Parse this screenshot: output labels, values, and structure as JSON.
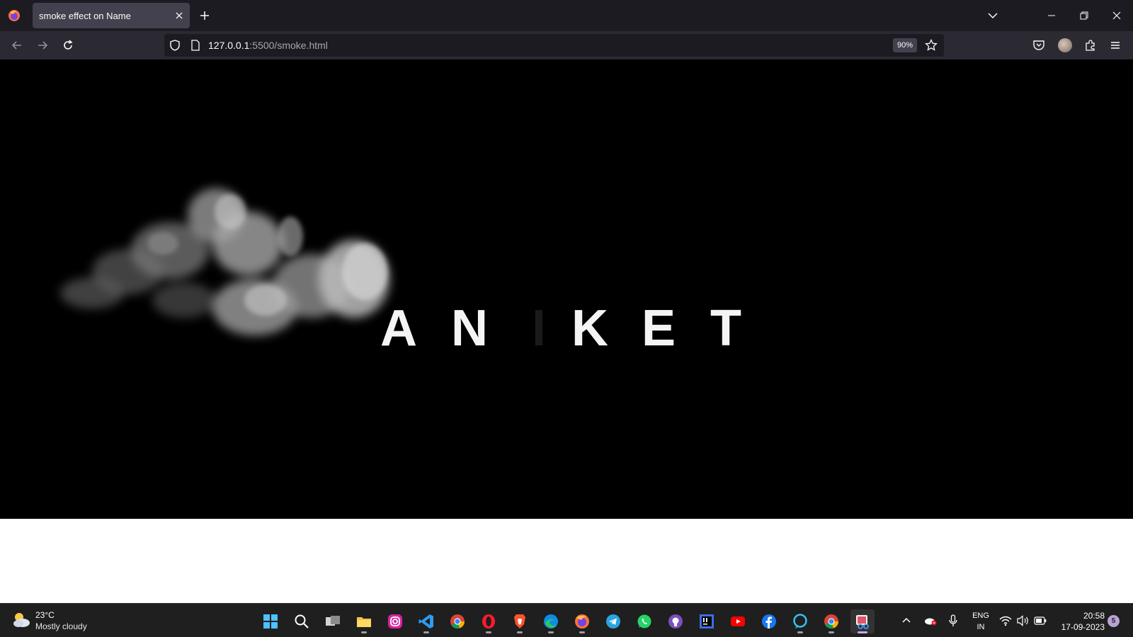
{
  "browser": {
    "tab": {
      "title": "smoke effect on Name"
    },
    "url": {
      "host": "127.0.0.1",
      "path": ":5500/smoke.html"
    },
    "zoom": "90%"
  },
  "page": {
    "letters": [
      "A",
      "N",
      "I",
      "K",
      "E",
      "T"
    ]
  },
  "taskbar": {
    "weather": {
      "temp": "23°C",
      "condition": "Mostly cloudy"
    },
    "apps": [
      {
        "name": "start",
        "icon": "windows-icon"
      },
      {
        "name": "search",
        "icon": "search-icon"
      },
      {
        "name": "task-view",
        "icon": "task-view-icon"
      },
      {
        "name": "file-explorer",
        "icon": "folder-icon"
      },
      {
        "name": "instagram",
        "icon": "instagram-icon"
      },
      {
        "name": "vscode",
        "icon": "vscode-icon"
      },
      {
        "name": "chrome",
        "icon": "chrome-icon"
      },
      {
        "name": "opera",
        "icon": "opera-icon"
      },
      {
        "name": "brave",
        "icon": "brave-icon"
      },
      {
        "name": "edge",
        "icon": "edge-icon"
      },
      {
        "name": "firefox",
        "icon": "firefox-icon"
      },
      {
        "name": "telegram",
        "icon": "telegram-icon"
      },
      {
        "name": "whatsapp",
        "icon": "whatsapp-icon"
      },
      {
        "name": "github-desktop",
        "icon": "github-icon"
      },
      {
        "name": "intellij",
        "icon": "intellij-icon"
      },
      {
        "name": "youtube",
        "icon": "youtube-icon"
      },
      {
        "name": "facebook",
        "icon": "facebook-icon"
      },
      {
        "name": "alexa",
        "icon": "alexa-icon"
      },
      {
        "name": "chrome-2",
        "icon": "chrome-icon"
      },
      {
        "name": "snipping-tool",
        "icon": "snipping-tool-icon"
      }
    ],
    "language": {
      "line1": "ENG",
      "line2": "IN"
    },
    "clock": {
      "time": "20:58",
      "date": "17-09-2023"
    },
    "notifications": "5"
  }
}
